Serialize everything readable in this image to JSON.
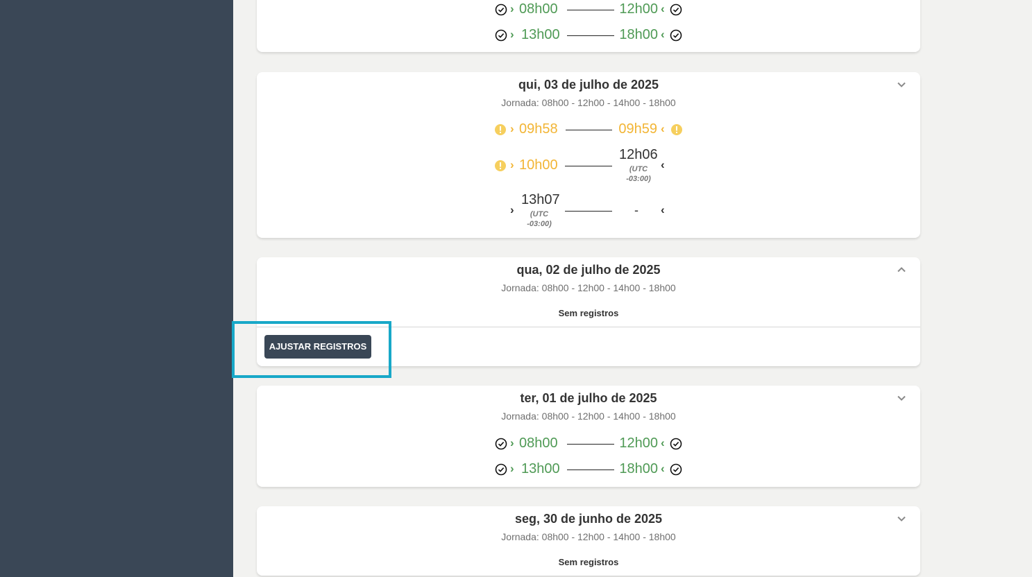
{
  "colors": {
    "sidebar": "#3a4756",
    "ok": "#4f9a55",
    "warning": "#f2b535",
    "highlight": "#18a8c8"
  },
  "card0": {
    "rows": [
      {
        "in": "08h00",
        "out": "12h00"
      },
      {
        "in": "13h00",
        "out": "18h00"
      }
    ]
  },
  "card1": {
    "title": "qui, 03 de julho de 2025",
    "jornada": "Jornada: 08h00 - 12h00 - 14h00 - 18h00",
    "rows": [
      {
        "in": "09h58",
        "out": "09h59"
      },
      {
        "in": "10h00",
        "out": "12h06",
        "out_tz_1": "(UTC",
        "out_tz_2": "-03:00)"
      },
      {
        "in": "13h07",
        "in_tz_1": "(UTC",
        "in_tz_2": "-03:00)",
        "out": "-"
      }
    ]
  },
  "card2": {
    "title": "qua, 02 de julho de 2025",
    "jornada": "Jornada: 08h00 - 12h00 - 14h00 - 18h00",
    "empty": "Sem registros",
    "button": "AJUSTAR REGISTROS"
  },
  "card3": {
    "title": "ter, 01 de julho de 2025",
    "jornada": "Jornada: 08h00 - 12h00 - 14h00 - 18h00",
    "rows": [
      {
        "in": "08h00",
        "out": "12h00"
      },
      {
        "in": "13h00",
        "out": "18h00"
      }
    ]
  },
  "card4": {
    "title": "seg, 30 de junho de 2025",
    "jornada": "Jornada: 08h00 - 12h00 - 14h00 - 18h00",
    "empty": "Sem registros"
  }
}
